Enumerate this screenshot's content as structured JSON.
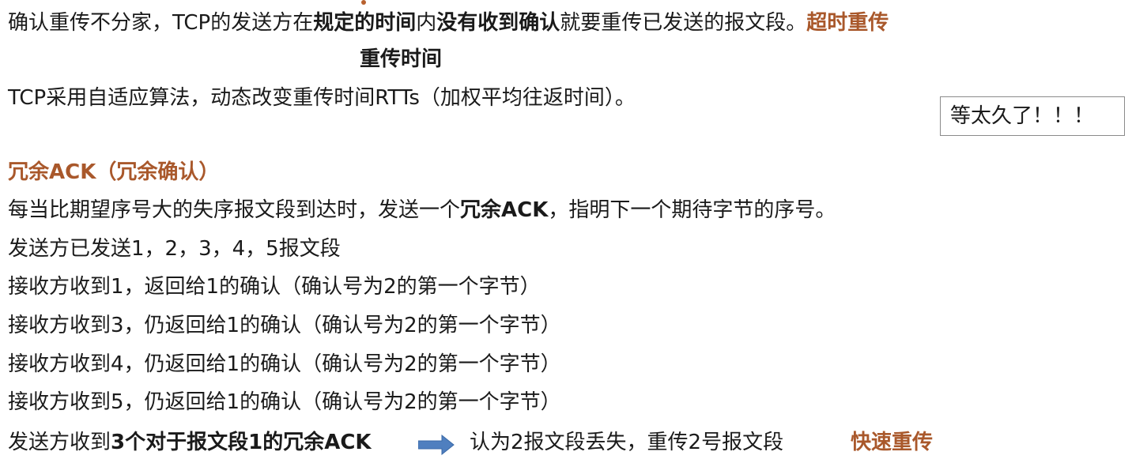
{
  "timeout": {
    "line1": {
      "p1": "确认重传不分家，TCP的发送方在",
      "b1": "规定的时间",
      "p2": "内",
      "b2": "没有收到确认",
      "p3": "就要重传已发送的报文段。",
      "tag": "超时重传"
    },
    "retransmit_time_label": "重传时间",
    "line3": "TCP采用自适应算法，动态改变重传时间RTTs（加权平均往返时间）。",
    "note": "等太久了！！！"
  },
  "redundant": {
    "heading": "冗余ACK（冗余确认）",
    "desc": {
      "p1": "每当比期望序号大的失序报文段到达时，发送一个",
      "b1": "冗余ACK",
      "p2": "，指明下一个期待字节的序号。"
    },
    "lines": [
      "发送方已发送1，2，3，4，5报文段",
      "接收方收到1，返回给1的确认（确认号为2的第一个字节）",
      "接收方收到3，仍返回给1的确认（确认号为2的第一个字节）",
      "接收方收到4，仍返回给1的确认（确认号为2的第一个字节）",
      "接收方收到5，仍返回给1的确认（确认号为2的第一个字节）"
    ],
    "final": {
      "p1": "发送方收到",
      "b1": "3个对于报文段1的冗余ACK",
      "p2": "认为2报文段丢失，重传2号报文段",
      "tag": "快速重传"
    }
  },
  "colors": {
    "accent": "#a9582b",
    "arrow": "#4f7fbf"
  }
}
